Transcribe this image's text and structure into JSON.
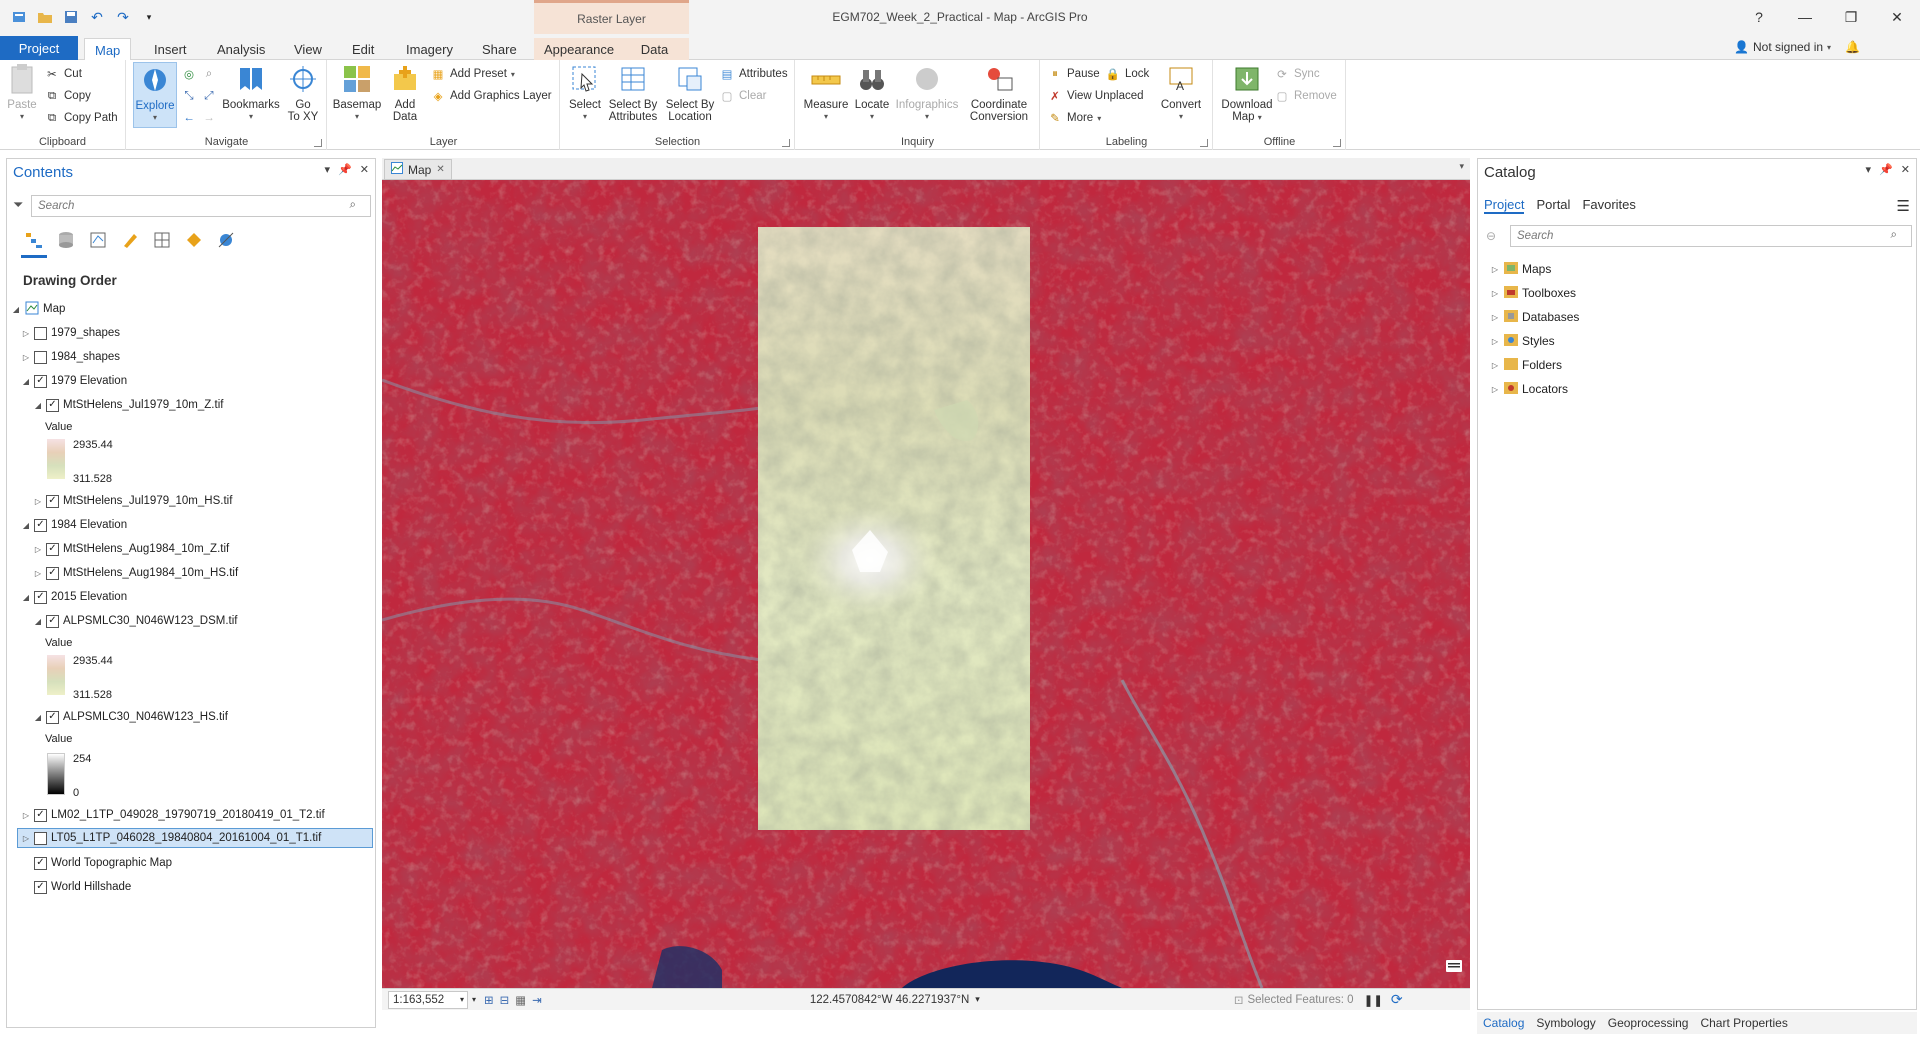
{
  "window": {
    "title": "EGM702_Week_2_Practical - Map - ArcGIS Pro",
    "context_tab_header": "Raster Layer",
    "help": "?",
    "signin": "Not signed in"
  },
  "tabs": [
    "Project",
    "Map",
    "Insert",
    "Analysis",
    "View",
    "Edit",
    "Imagery",
    "Share",
    "Appearance",
    "Data"
  ],
  "ribbon": {
    "clipboard": {
      "label": "Clipboard",
      "paste": "Paste",
      "cut": "Cut",
      "copy": "Copy",
      "copy_path": "Copy Path"
    },
    "navigate": {
      "label": "Navigate",
      "explore": "Explore",
      "bookmarks": "Bookmarks",
      "go_to_xy_1": "Go",
      "go_to_xy_2": "To XY"
    },
    "layer": {
      "label": "Layer",
      "basemap": "Basemap",
      "add_data_1": "Add",
      "add_data_2": "Data",
      "add_preset": "Add Preset",
      "add_graphics_layer": "Add Graphics Layer"
    },
    "selection": {
      "label": "Selection",
      "select": "Select",
      "select_by_attr_1": "Select By",
      "select_by_attr_2": "Attributes",
      "select_by_loc_1": "Select By",
      "select_by_loc_2": "Location",
      "attributes": "Attributes",
      "clear": "Clear"
    },
    "inquiry": {
      "label": "Inquiry",
      "measure": "Measure",
      "locate": "Locate",
      "infographics": "Infographics",
      "coord_conv_1": "Coordinate",
      "coord_conv_2": "Conversion"
    },
    "labeling": {
      "label": "Labeling",
      "pause": "Pause",
      "lock": "Lock",
      "view_unplaced": "View Unplaced",
      "more": "More",
      "convert": "Convert"
    },
    "offline": {
      "label": "Offline",
      "download_map_1": "Download",
      "download_map_2": "Map",
      "sync": "Sync",
      "remove": "Remove"
    }
  },
  "contents": {
    "title": "Contents",
    "search_placeholder": "Search",
    "drawing_order": "Drawing Order",
    "map_label": "Map",
    "layers": {
      "shapes1979": "1979_shapes",
      "shapes1984": "1984_shapes",
      "elev1979": "1979 Elevation",
      "z1979": "MtStHelens_Jul1979_10m_Z.tif",
      "value1": "Value",
      "max1": "2935.44",
      "min1": "311.528",
      "hs1979": "MtStHelens_Jul1979_10m_HS.tif",
      "elev1984": "1984 Elevation",
      "z1984": "MtStHelens_Aug1984_10m_Z.tif",
      "hs1984": "MtStHelens_Aug1984_10m_HS.tif",
      "elev2015": "2015 Elevation",
      "dsm": "ALPSMLC30_N046W123_DSM.tif",
      "value2": "Value",
      "max2": "2935.44",
      "min2": "311.528",
      "hs2015": "ALPSMLC30_N046W123_HS.tif",
      "value3": "Value",
      "max3": "254",
      "min3": "0",
      "lm02": "LM02_L1TP_049028_19790719_20180419_01_T2.tif",
      "lt05": "LT05_L1TP_046028_19840804_20161004_01_T1.tif",
      "topo": "World Topographic Map",
      "hillshade": "World Hillshade"
    }
  },
  "map": {
    "tab_label": "Map",
    "scale": "1:163,552",
    "coords": "122.4570842°W 46.2271937°N",
    "selected_features": "Selected Features: 0"
  },
  "catalog": {
    "title": "Catalog",
    "tabs": [
      "Project",
      "Portal",
      "Favorites"
    ],
    "search_placeholder": "Search",
    "items": [
      "Maps",
      "Toolboxes",
      "Databases",
      "Styles",
      "Folders",
      "Locators"
    ]
  },
  "bottom_tabs": [
    "Catalog",
    "Symbology",
    "Geoprocessing",
    "Chart Properties"
  ],
  "colors": {
    "accent": "#1e6bc4",
    "contextual": "#f6e3d6",
    "selection": "#cfe3f7"
  }
}
